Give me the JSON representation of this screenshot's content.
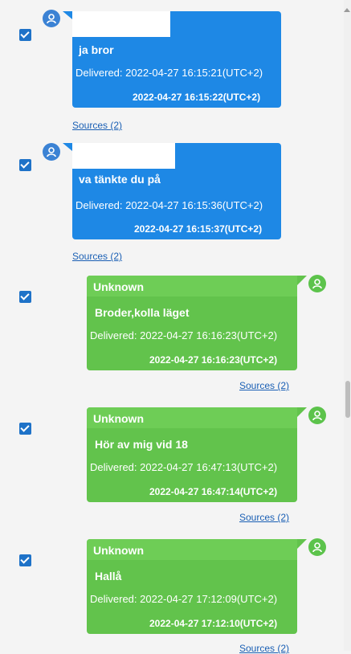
{
  "messages": [
    {
      "direction": "outgoing",
      "checked": true,
      "body": "ja bror",
      "delivered": "Delivered: 2022-04-27 16:15:21(UTC+2)",
      "timestamp": "2022-04-27 16:15:22(UTC+2)",
      "sources": "Sources (2)"
    },
    {
      "direction": "outgoing",
      "checked": true,
      "body": "va tänkte du på",
      "delivered": "Delivered: 2022-04-27 16:15:36(UTC+2)",
      "timestamp": "2022-04-27 16:15:37(UTC+2)",
      "sources": "Sources (2)"
    },
    {
      "direction": "incoming",
      "checked": true,
      "sender": "Unknown",
      "body": "Broder,kolla läget",
      "delivered": "Delivered: 2022-04-27 16:16:23(UTC+2)",
      "timestamp": "2022-04-27 16:16:23(UTC+2)",
      "sources": "Sources (2)"
    },
    {
      "direction": "incoming",
      "checked": true,
      "sender": "Unknown",
      "body": "Hör av mig vid 18",
      "delivered": "Delivered: 2022-04-27 16:47:13(UTC+2)",
      "timestamp": "2022-04-27 16:47:14(UTC+2)",
      "sources": "Sources (2)"
    },
    {
      "direction": "incoming",
      "checked": true,
      "sender": "Unknown",
      "body": "Hallå",
      "delivered": "Delivered: 2022-04-27 17:12:09(UTC+2)",
      "timestamp": "2022-04-27 17:12:10(UTC+2)",
      "sources": "Sources (2)"
    }
  ],
  "colors": {
    "outgoing_bubble": "#1e88e5",
    "incoming_bubble": "#62c34c",
    "checkbox": "#1e72c8",
    "link": "#1a5fb4"
  },
  "icons": {
    "avatar": "person-icon",
    "checkbox": "checkmark-icon"
  }
}
